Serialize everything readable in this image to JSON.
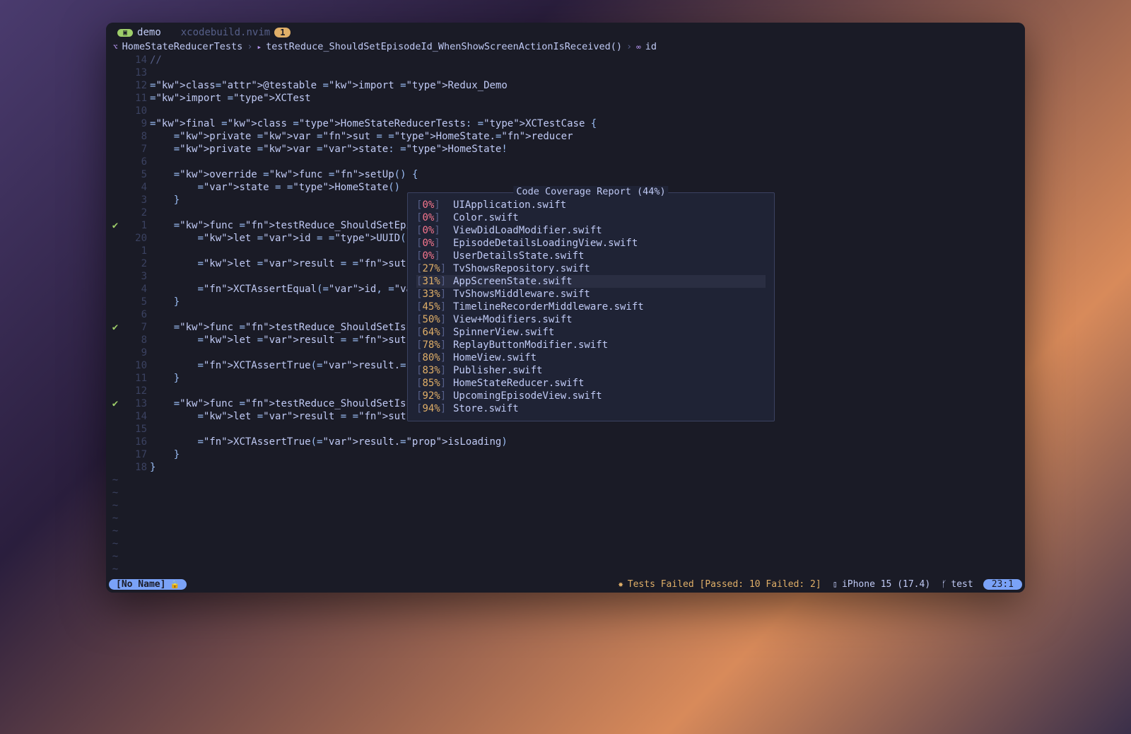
{
  "tabs": {
    "active_pill_icon": "▣",
    "active_pill_text": "",
    "active_label": "demo",
    "secondary_label": "xcodebuild.nvim",
    "secondary_badge": "1"
  },
  "breadcrumb": {
    "part1": "HomeStateReducerTests",
    "part2": "testReduce_ShouldSetEpisodeId_WhenShowScreenActionIsReceived()",
    "part3": "id"
  },
  "gutter_lines": [
    "14",
    "13",
    "12",
    "11",
    "10",
    "9",
    "8",
    "7",
    "6",
    "5",
    "4",
    "3",
    "2",
    "1",
    "20",
    "1",
    "2",
    "3",
    "4",
    "5",
    "6",
    "7",
    "8",
    "9",
    "10",
    "11",
    "12",
    "13",
    "14",
    "15",
    "16",
    "17",
    "18"
  ],
  "gutter_signs": [
    "",
    "",
    "",
    "",
    "",
    "",
    "",
    "",
    "",
    "",
    "",
    "",
    "",
    "✔",
    "",
    "",
    "",
    "",
    "",
    "",
    "",
    "✔",
    "",
    "",
    "",
    "",
    "",
    "✔",
    "",
    "",
    "",
    "",
    ""
  ],
  "code_lines": [
    {
      "raw": "//",
      "cls": "cmt"
    },
    {
      "raw": ""
    },
    {
      "raw": "@testable import Redux_Demo"
    },
    {
      "raw": "import XCTest"
    },
    {
      "raw": ""
    },
    {
      "raw": "final class HomeStateReducerTests: XCTestCase {"
    },
    {
      "raw": "    private var sut = HomeState.reducer"
    },
    {
      "raw": "    private var state: HomeState!"
    },
    {
      "raw": ""
    },
    {
      "raw": "    override func setUp() {"
    },
    {
      "raw": "        state = HomeState()"
    },
    {
      "raw": "    }"
    },
    {
      "raw": ""
    },
    {
      "raw": "    func testReduce_ShouldSetEpisodeId_When"
    },
    {
      "raw": "        let id = UUID()"
    },
    {
      "raw": ""
    },
    {
      "raw": "        let result = sut(state, ActiveScree"
    },
    {
      "raw": ""
    },
    {
      "raw": "        XCTAssertEqual(id, result.presented"
    },
    {
      "raw": "    }"
    },
    {
      "raw": ""
    },
    {
      "raw": "    func testReduce_ShouldSetIsLoadingTrue_"
    },
    {
      "raw": "        let result = sut(state, HomeStateAc"
    },
    {
      "raw": ""
    },
    {
      "raw": "        XCTAssertTrue(result.isLoading)"
    },
    {
      "raw": "    }"
    },
    {
      "raw": ""
    },
    {
      "raw": "    func testReduce_ShouldSetIsLoadingTrue_"
    },
    {
      "raw": "        let result = sut(state, HomeStateAc"
    },
    {
      "raw": ""
    },
    {
      "raw": "        XCTAssertTrue(result.isLoading)"
    },
    {
      "raw": "    }"
    },
    {
      "raw": "}"
    }
  ],
  "tildes": 8,
  "coverage": {
    "title": "Code Coverage Report (44%)",
    "selected_index": 6,
    "rows": [
      {
        "pct": "0%",
        "cls": "red",
        "file": "UIApplication.swift"
      },
      {
        "pct": "0%",
        "cls": "red",
        "file": "Color.swift"
      },
      {
        "pct": "0%",
        "cls": "red",
        "file": "ViewDidLoadModifier.swift"
      },
      {
        "pct": "0%",
        "cls": "red",
        "file": "EpisodeDetailsLoadingView.swift"
      },
      {
        "pct": "0%",
        "cls": "red",
        "file": "UserDetailsState.swift"
      },
      {
        "pct": "27%",
        "cls": "yel",
        "file": "TvShowsRepository.swift"
      },
      {
        "pct": "31%",
        "cls": "yel",
        "file": "AppScreenState.swift"
      },
      {
        "pct": "33%",
        "cls": "yel",
        "file": "TvShowsMiddleware.swift"
      },
      {
        "pct": "45%",
        "cls": "yel",
        "file": "TimelineRecorderMiddleware.swift"
      },
      {
        "pct": "50%",
        "cls": "yel",
        "file": "View+Modifiers.swift"
      },
      {
        "pct": "64%",
        "cls": "yel",
        "file": "SpinnerView.swift"
      },
      {
        "pct": "78%",
        "cls": "yel",
        "file": "ReplayButtonModifier.swift"
      },
      {
        "pct": "80%",
        "cls": "yel",
        "file": "HomeView.swift"
      },
      {
        "pct": "83%",
        "cls": "yel",
        "file": "Publisher.swift"
      },
      {
        "pct": "85%",
        "cls": "yel",
        "file": "HomeStateReducer.swift"
      },
      {
        "pct": "92%",
        "cls": "yel",
        "file": "UpcomingEpisodeView.swift"
      },
      {
        "pct": "94%",
        "cls": "yel",
        "file": "Store.swift"
      }
    ]
  },
  "statusbar": {
    "filename": "[No Name]",
    "tests": "Tests Failed [Passed: 10 Failed: 2]",
    "device": "iPhone 15 (17.4)",
    "branch": "test",
    "pos": "23:1"
  }
}
